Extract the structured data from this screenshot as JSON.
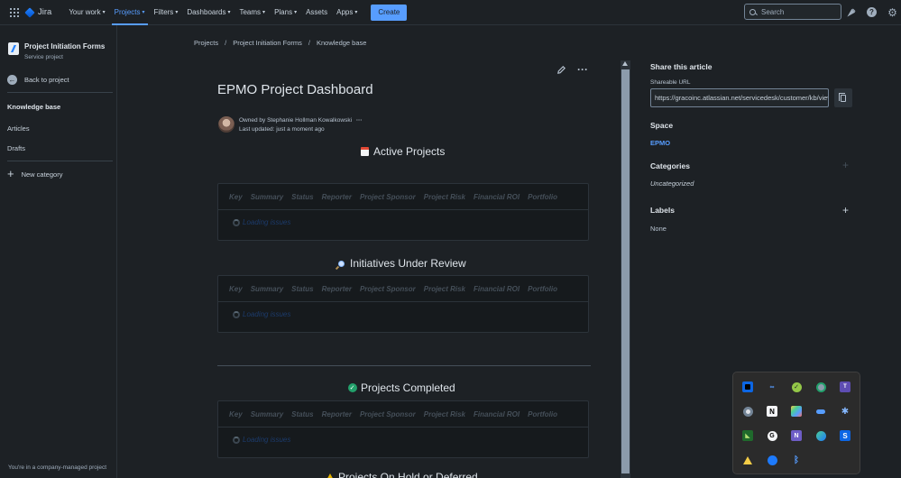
{
  "topnav": {
    "logo_text": "Jira",
    "items": [
      {
        "label": "Your work",
        "active": false
      },
      {
        "label": "Projects",
        "active": true
      },
      {
        "label": "Filters",
        "active": false
      },
      {
        "label": "Dashboards",
        "active": false
      },
      {
        "label": "Teams",
        "active": false
      },
      {
        "label": "Plans",
        "active": false
      },
      {
        "label": "Assets",
        "active": false
      },
      {
        "label": "Apps",
        "active": false
      }
    ],
    "create_label": "Create",
    "search_placeholder": "Search",
    "icons": [
      "notifications-icon",
      "help-icon",
      "settings-icon"
    ]
  },
  "sidebar": {
    "project_name": "Project Initiation Forms",
    "project_type": "Service project",
    "back_label": "Back to project",
    "kb_label": "Knowledge base",
    "articles_label": "Articles",
    "drafts_label": "Drafts",
    "new_category_label": "New category",
    "managed_text": "You're in a company-managed project"
  },
  "breadcrumb": [
    "Projects",
    "Project Initiation Forms",
    "Knowledge base"
  ],
  "article": {
    "title": "EPMO Project Dashboard",
    "owner": "Owned by Stephanie Hollman Kowalkowski",
    "updated": "Last updated: just a moment ago",
    "columns": [
      "Key",
      "Summary",
      "Status",
      "Reporter",
      "Project Sponsor",
      "Project Risk",
      "Financial ROI",
      "Portfolio"
    ],
    "loading_text": "Loading issues",
    "sections": [
      {
        "title": "Active Projects",
        "emoji": "calendar-icon"
      },
      {
        "title": "Initiatives Under Review",
        "emoji": "magnifier-icon"
      },
      {
        "title": "Projects Completed",
        "emoji": "check-icon"
      },
      {
        "title": "Projects On Hold or Deferred",
        "emoji": "warning-icon"
      }
    ]
  },
  "right_panel": {
    "share_title": "Share this article",
    "shareable_label": "Shareable URL",
    "shareable_url": "https://gracoinc.atlassian.net/servicedesk/customer/kb/view",
    "space_title": "Space",
    "space_value": "EPMO",
    "categories_title": "Categories",
    "categories_value": "Uncategorized",
    "labels_title": "Labels",
    "labels_value": "None"
  },
  "tray": {
    "icons": [
      "app-blue-square-icon",
      "link-icon",
      "check-circle-icon",
      "globe-sync-icon",
      "teams-icon",
      "chrome-icon",
      "notion-icon",
      "photos-icon",
      "onedrive-icon",
      "gear-icon",
      "nvidia-icon",
      "g-app-icon",
      "onenote-icon",
      "edge-icon",
      "skype-icon",
      "warning-shield-icon",
      "chat-icon",
      "bluetooth-icon"
    ]
  },
  "colors": {
    "accent": "#579dff",
    "background": "#1d2125",
    "panel": "#161a1d"
  }
}
